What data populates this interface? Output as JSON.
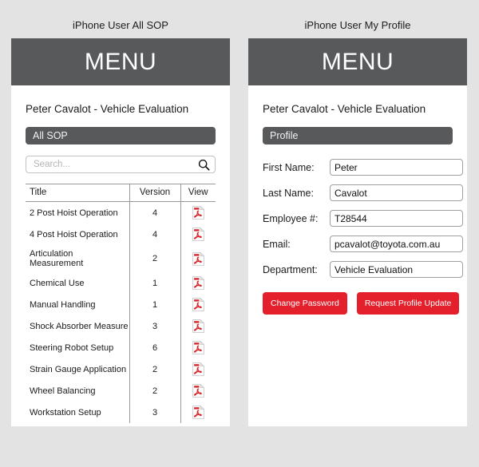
{
  "panels": {
    "left": {
      "caption": "iPhone User All SOP",
      "menu_title": "MENU",
      "user_line": "Peter Cavalot - Vehicle Evaluation",
      "section_label": "All SOP",
      "search_placeholder": "Search...",
      "search_value": "",
      "search_icon": "magnifier-icon",
      "table": {
        "columns": [
          "Title",
          "Version",
          "View"
        ],
        "rows": [
          {
            "title": "2 Post Hoist Operation",
            "version": "4",
            "view_icon": "pdf-icon"
          },
          {
            "title": "4 Post Hoist Operation",
            "version": "4",
            "view_icon": "pdf-icon"
          },
          {
            "title": "Articulation Measurement",
            "version": "2",
            "view_icon": "pdf-icon"
          },
          {
            "title": "Chemical Use",
            "version": "1",
            "view_icon": "pdf-icon"
          },
          {
            "title": "Manual Handling",
            "version": "1",
            "view_icon": "pdf-icon"
          },
          {
            "title": "Shock Absorber Measure",
            "version": "3",
            "view_icon": "pdf-icon"
          },
          {
            "title": "Steering Robot Setup",
            "version": "6",
            "view_icon": "pdf-icon"
          },
          {
            "title": "Strain Gauge Application",
            "version": "2",
            "view_icon": "pdf-icon"
          },
          {
            "title": "Wheel Balancing",
            "version": "2",
            "view_icon": "pdf-icon"
          },
          {
            "title": "Workstation Setup",
            "version": "3",
            "view_icon": "pdf-icon"
          }
        ]
      }
    },
    "right": {
      "caption": "iPhone User My Profile",
      "menu_title": "MENU",
      "user_line": "Peter Cavalot - Vehicle Evaluation",
      "section_label": "Profile",
      "fields": [
        {
          "label": "First Name:",
          "value": "Peter"
        },
        {
          "label": "Last Name:",
          "value": "Cavalot"
        },
        {
          "label": "Employee #:",
          "value": "T28544"
        },
        {
          "label": "Email:",
          "value": "pcavalot@toyota.com.au"
        },
        {
          "label": "Department:",
          "value": "Vehicle Evaluation"
        }
      ],
      "buttons": {
        "change_password": "Change Password",
        "request_profile_update": "Request Profile Update"
      }
    }
  },
  "colors": {
    "page_background": "#e3e3e3",
    "panel_background": "#ffffff",
    "menu_bar": "#58595b",
    "section_bar": "#58595b",
    "button_red": "#e3202c",
    "pdf_red": "#d7262b",
    "table_rule": "#9a9a9a",
    "input_border": "#9f9f9f",
    "placeholder_text": "#b4b4b4"
  }
}
